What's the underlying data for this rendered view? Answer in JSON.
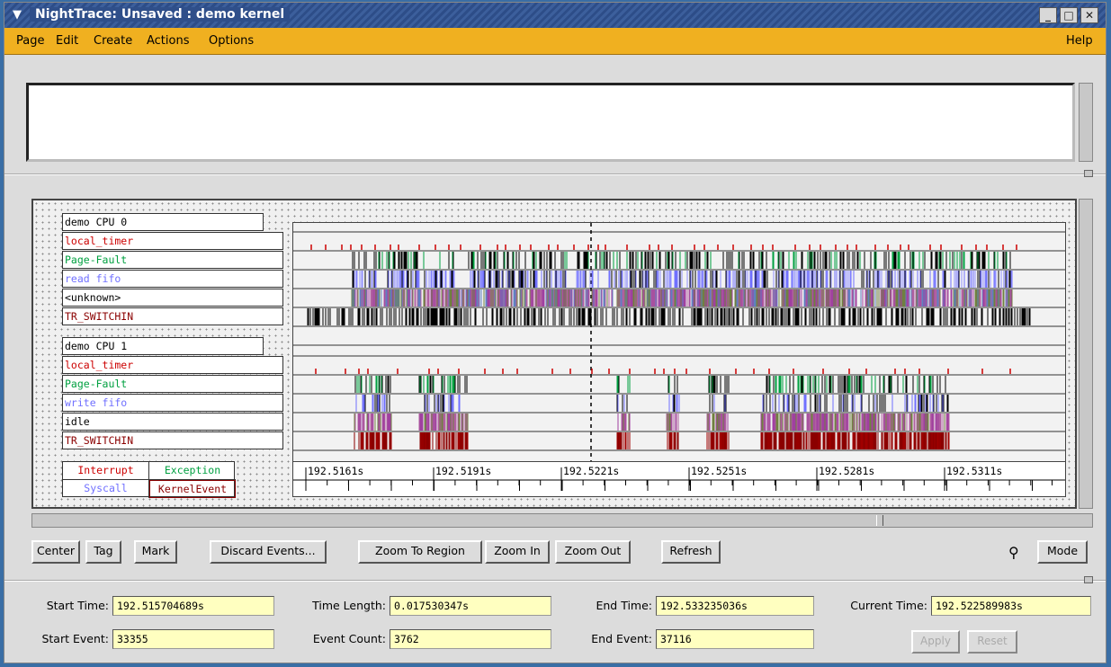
{
  "window": {
    "title": "NightTrace: Unsaved : demo kernel"
  },
  "menu": {
    "page": "Page",
    "edit": "Edit",
    "create": "Create",
    "actions": "Actions",
    "options": "Options",
    "help": "Help"
  },
  "graph": {
    "cpu0": {
      "header": "demo CPU 0",
      "rows": [
        "local_timer",
        "Page-Fault",
        "read fifo",
        "<unknown>",
        "TR_SWITCHIN"
      ]
    },
    "cpu1": {
      "header": "demo CPU 1",
      "rows": [
        "local_timer",
        "Page-Fault",
        "write fifo",
        "idle",
        "TR_SWITCHIN"
      ]
    },
    "legend": {
      "interrupt": "Interrupt",
      "exception": "Exception",
      "syscall": "Syscall",
      "kernel_event": "KernelEvent"
    },
    "axis_ticks": [
      "192.5161s",
      "192.5191s",
      "192.5221s",
      "192.5251s",
      "192.5281s",
      "192.5311s"
    ],
    "colors": {
      "interrupt": "#cc0000",
      "exception": "#00a040",
      "syscall": "#7070ff",
      "kernel_event": "#8b0000"
    }
  },
  "buttons": {
    "center": "Center",
    "tag": "Tag",
    "mark": "Mark",
    "discard": "Discard Events...",
    "zoom_region": "Zoom To Region",
    "zoom_in": "Zoom In",
    "zoom_out": "Zoom Out",
    "refresh": "Refresh",
    "mode": "Mode"
  },
  "fields": {
    "start_time_label": "Start Time:",
    "start_time": "192.515704689s",
    "time_length_label": "Time Length:",
    "time_length": "0.017530347s",
    "end_time_label": "End Time:",
    "end_time": "192.533235036s",
    "current_time_label": "Current Time:",
    "current_time": "192.522589983s",
    "start_event_label": "Start Event:",
    "start_event": "33355",
    "event_count_label": "Event Count:",
    "event_count": "3762",
    "end_event_label": "End Event:",
    "end_event": "37116"
  },
  "bottom": {
    "apply": "Apply",
    "reset": "Reset"
  }
}
